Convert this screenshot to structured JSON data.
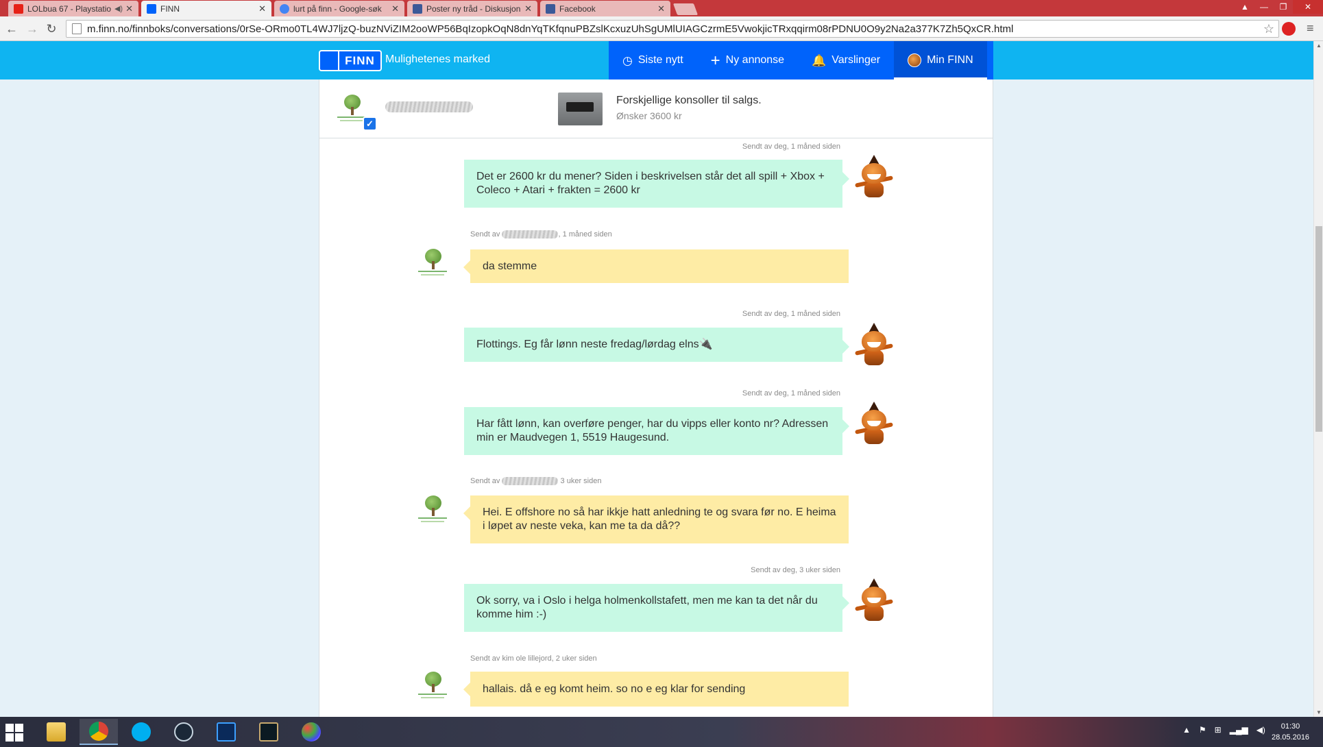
{
  "browser": {
    "tabs": [
      {
        "label": "LOLbua 67 - Playstatio",
        "favicon": "youtube-icon",
        "favicon_color": "#e62117",
        "audio": true
      },
      {
        "label": "FINN",
        "favicon": "finn-icon",
        "favicon_color": "#0063fb",
        "active": true
      },
      {
        "label": "lurt på finn - Google-søk",
        "favicon": "google-icon",
        "favicon_color": "#4285f4"
      },
      {
        "label": "Poster ny tråd - Diskusjon",
        "favicon": "forum-icon",
        "favicon_color": "#3b5998"
      },
      {
        "label": "Facebook",
        "favicon": "facebook-icon",
        "favicon_color": "#3b5998"
      }
    ],
    "url": "m.finn.no/finnboks/conversations/0rSe-ORmo0TL4WJ7ljzQ-buzNViZIM2ooWP56BqIzopkOqN8dnYqTKfqnuPBZslKcxuzUhSgUMlUIAGCzrmE5VwokjicTRxqqirm08rPDNU0O9y2Na2a377K7Zh5QxCR.html"
  },
  "header": {
    "logo_text": "FINN",
    "tagline": "Mulighetenes marked",
    "nav": [
      {
        "label": "Siste nytt",
        "icon": "clock-icon",
        "glyph": "◷"
      },
      {
        "label": "Ny annonse",
        "icon": "plus-icon",
        "glyph": "+"
      },
      {
        "label": "Varslinger",
        "icon": "bell-icon",
        "glyph": "🔔"
      },
      {
        "label": "Min FINN",
        "icon": "avatar-icon",
        "active": true
      }
    ],
    "colors": {
      "bar": "#0fb4f1",
      "nav_bg": "#0063fb"
    }
  },
  "listing": {
    "title": "Forskjellige konsoller til salgs.",
    "price": "Ønsker 3600 kr"
  },
  "messages": [
    {
      "from": "me",
      "meta": "Sendt av deg, 1 måned siden",
      "text": "Det er 2600 kr du mener? Siden i beskrivelsen står det all spill + Xbox + Coleco + Atari + frakten = 2600 kr"
    },
    {
      "from": "them",
      "meta_prefix": "Sendt av",
      "meta_suffix": ", 1 måned siden",
      "text": "da stemme"
    },
    {
      "from": "me",
      "meta": "Sendt av deg, 1 måned siden",
      "text": "Flottings. Eg får lønn neste fredag/lørdag elns🔌"
    },
    {
      "from": "me",
      "meta": "Sendt av deg, 1 måned siden",
      "text": "Har fått lønn, kan overføre penger, har du vipps eller konto nr? Adressen min er Maudvegen 1, 5519 Haugesund."
    },
    {
      "from": "them",
      "meta_prefix": "Sendt av",
      "meta_suffix": " 3 uker siden",
      "text": "Hei. E offshore no så har ikkje hatt anledning te og svara før no. E heima i løpet av neste veka, kan me ta da då??"
    },
    {
      "from": "me",
      "meta": "Sendt av deg, 3 uker siden",
      "text": "Ok sorry, va i Oslo i helga holmenkollstafett, men me kan ta det når du komme him :-)"
    },
    {
      "from": "them",
      "meta": "Sendt av kim ole lillejord, 2 uker siden",
      "text": "hallais. då e eg komt heim. so no e eg klar for sending"
    }
  ],
  "colors": {
    "mine_bubble": "#c7f9e4",
    "their_bubble": "#feeca5",
    "page_bg": "#e5f1f8"
  },
  "taskbar": {
    "time": "01:30",
    "date": "28.05.2016"
  }
}
